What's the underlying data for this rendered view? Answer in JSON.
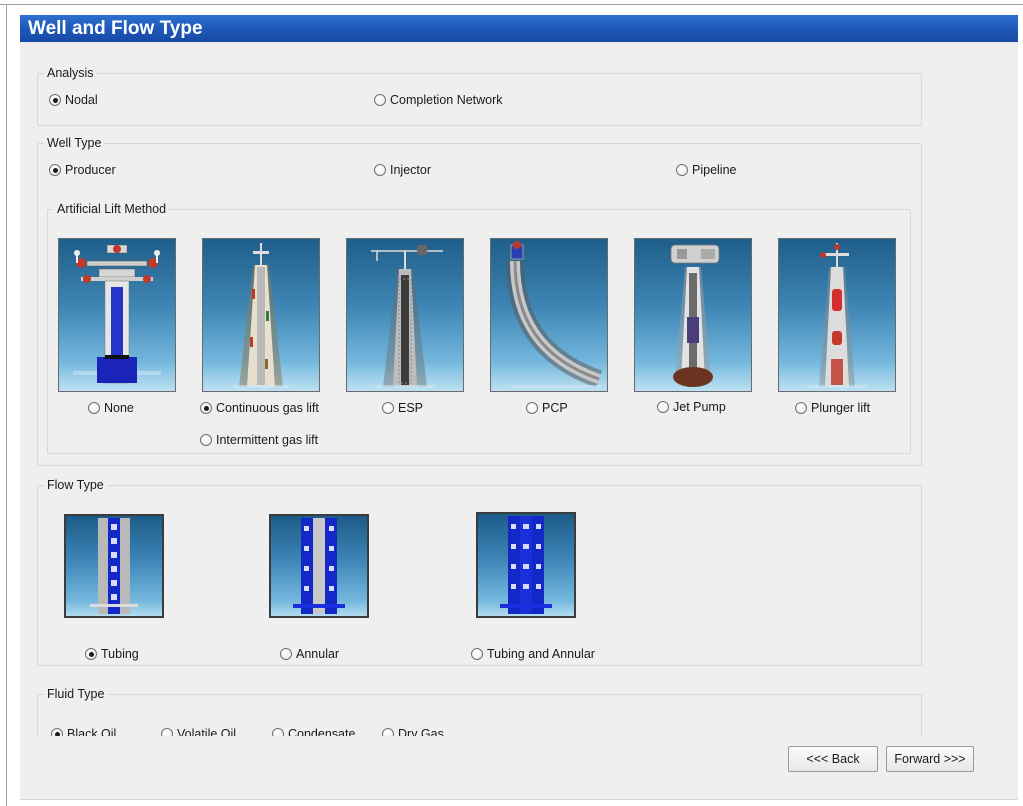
{
  "page": {
    "title": "Well and Flow Type"
  },
  "analysis": {
    "legend": "Analysis",
    "options": [
      {
        "label": "Nodal",
        "selected": true
      },
      {
        "label": "Completion Network",
        "selected": false
      }
    ]
  },
  "well_type": {
    "legend": "Well Type",
    "options": [
      {
        "label": "Producer",
        "selected": true
      },
      {
        "label": "Injector",
        "selected": false
      },
      {
        "label": "Pipeline",
        "selected": false
      }
    ]
  },
  "artificial_lift": {
    "legend": "Artificial Lift Method",
    "options": [
      {
        "label": "None",
        "selected": false,
        "icon": "wellhead-tubing-icon"
      },
      {
        "label": "Continuous gas lift",
        "selected": true,
        "icon": "gas-lift-well-icon"
      },
      {
        "label": "Intermittent gas lift",
        "selected": false
      },
      {
        "label": "ESP",
        "selected": false,
        "icon": "esp-well-icon"
      },
      {
        "label": "PCP",
        "selected": false,
        "icon": "pcp-deviated-well-icon"
      },
      {
        "label": "Jet Pump",
        "selected": false,
        "icon": "jet-pump-well-icon"
      },
      {
        "label": "Plunger lift",
        "selected": false,
        "icon": "plunger-lift-well-icon"
      }
    ]
  },
  "flow_type": {
    "legend": "Flow Type",
    "options": [
      {
        "label": "Tubing",
        "selected": true,
        "icon": "tubing-flow-icon"
      },
      {
        "label": "Annular",
        "selected": false,
        "icon": "annular-flow-icon"
      },
      {
        "label": "Tubing and Annular",
        "selected": false,
        "icon": "tubing-and-annular-flow-icon"
      }
    ]
  },
  "fluid_type": {
    "legend": "Fluid Type",
    "options": [
      {
        "label": "Black Oil",
        "selected": true
      },
      {
        "label": "Volatile Oil",
        "selected": false
      },
      {
        "label": "Condensate",
        "selected": false
      },
      {
        "label": "Dry Gas",
        "selected": false
      }
    ]
  },
  "buttons": {
    "back": "<<< Back",
    "forward": "Forward >>>"
  },
  "colors": {
    "title_bar": "#1d57b7",
    "panel_background": "#efefef",
    "thumbnail_sky": "#3f86b5",
    "tubing_blue": "#1428c8"
  }
}
